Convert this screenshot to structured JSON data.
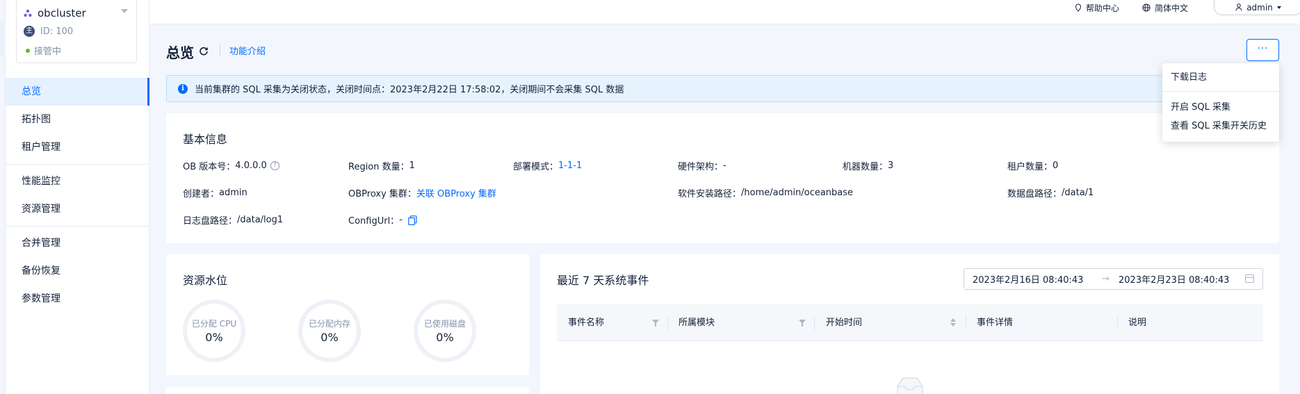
{
  "cluster": {
    "name": "obcluster",
    "id_label": "ID: 100",
    "status": "接管中"
  },
  "sidebar": {
    "items": [
      {
        "label": "总览",
        "active": true
      },
      {
        "label": "拓扑图"
      },
      {
        "label": "租户管理"
      },
      {
        "label": "性能监控"
      },
      {
        "label": "资源管理"
      },
      {
        "label": "合并管理"
      },
      {
        "label": "备份恢复"
      },
      {
        "label": "参数管理"
      }
    ]
  },
  "topbar": {
    "help": "帮助中心",
    "language": "简体中文",
    "user": "admin"
  },
  "header": {
    "title": "总览",
    "feature_link": "功能介绍",
    "more": "···"
  },
  "alert": {
    "text": "当前集群的 SQL 采集为关闭状态，关闭时间点：2023年2月22日 17:58:02，关闭期间不会采集 SQL 数据"
  },
  "basic_info": {
    "title": "基本信息",
    "ob_version_label": "OB 版本号：",
    "ob_version": "4.0.0.0",
    "region_label": "Region 数量：",
    "region": "1",
    "deploy_label": "部署模式：",
    "deploy": "1-1-1",
    "arch_label": "硬件架构：",
    "arch": "-",
    "machines_label": "机器数量：",
    "machines": "3",
    "tenants_label": "租户数量：",
    "tenants": "0",
    "creator_label": "创建者：",
    "creator": "admin",
    "obproxy_label": "OBProxy 集群：",
    "obproxy": "关联 OBProxy 集群",
    "install_path_label": "软件安装路径：",
    "install_path": "/home/admin/oceanbase",
    "data_path_label": "数据盘路径：",
    "data_path": "/data/1",
    "log_path_label": "日志盘路径：",
    "log_path": "/data/log1",
    "config_url_label": "ConfigUrl：",
    "config_url": "-"
  },
  "resources": {
    "title": "资源水位",
    "gauges": [
      {
        "label": "已分配 CPU",
        "value": "0%"
      },
      {
        "label": "已分配内存",
        "value": "0%"
      },
      {
        "label": "已使用磁盘",
        "value": "0%"
      }
    ]
  },
  "events": {
    "title": "最近 7 天系统事件",
    "range_start": "2023年2月16日 08:40:43",
    "range_arrow": "→",
    "range_end": "2023年2月23日 08:40:43",
    "columns": [
      "事件名称",
      "所属模块",
      "开始时间",
      "事件详情",
      "说明"
    ]
  },
  "menu": {
    "items": [
      "下载日志",
      "开启 SQL 采集",
      "查看 SQL 采集开关历史"
    ]
  },
  "colors": {
    "primary": "#006aff",
    "text": "#132039",
    "muted": "#8592ad",
    "background": "#f3f6fc",
    "alert_bg": "#e6f3ff",
    "status_green": "#52c41a"
  }
}
